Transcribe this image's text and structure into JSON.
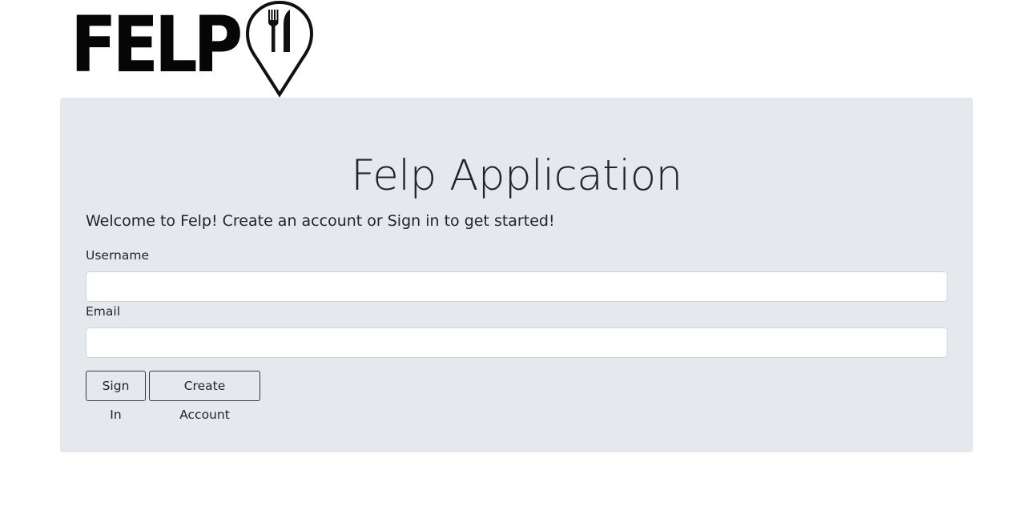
{
  "logo": {
    "text": "FELP",
    "icon": "map-pin-fork-knife-icon"
  },
  "main": {
    "title": "Felp Application",
    "welcome": "Welcome to Felp! Create an account or Sign in to get started!"
  },
  "form": {
    "username_label": "Username",
    "username_value": "",
    "email_label": "Email",
    "email_value": ""
  },
  "buttons": {
    "sign_in": "Sign In",
    "create_account": "Create Account"
  },
  "colors": {
    "panel_background": "#e5e8ed",
    "text": "#212529",
    "button_border": "#343a40"
  }
}
